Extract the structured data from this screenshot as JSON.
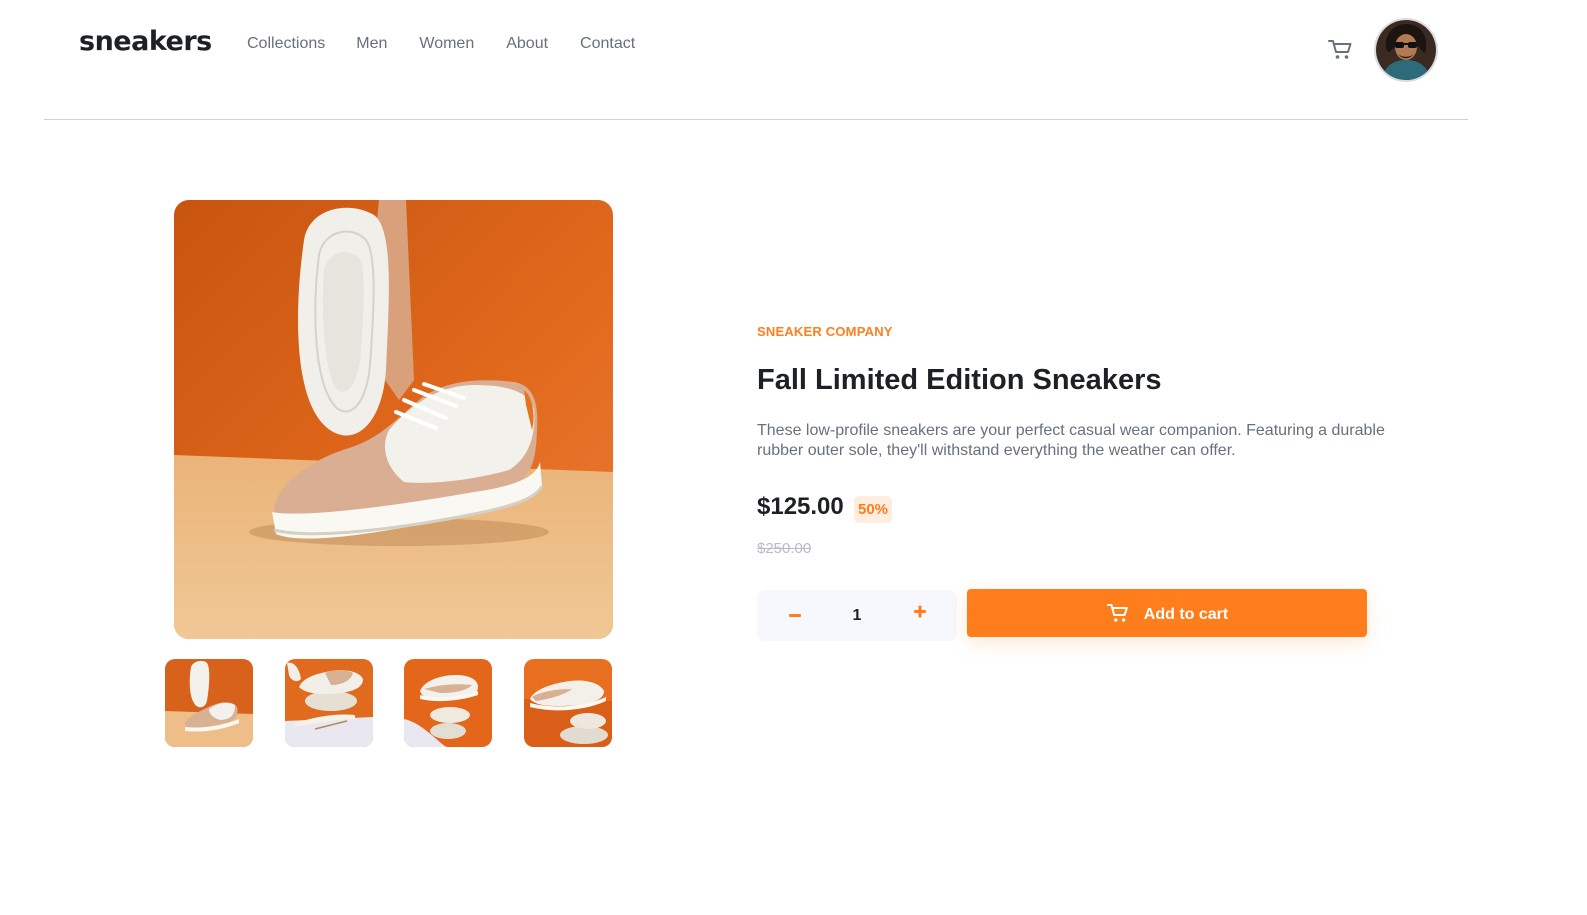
{
  "header": {
    "logo": "sneakers",
    "nav": [
      "Collections",
      "Men",
      "Women",
      "About",
      "Contact"
    ]
  },
  "product": {
    "company": "SNEAKER COMPANY",
    "title": "Fall Limited Edition Sneakers",
    "description": "These low-profile sneakers are your perfect casual wear companion. Featuring a durable rubber outer sole, they'll withstand everything the weather can offer.",
    "price": "$125.00",
    "discount": "50%",
    "original_price": "$250.00",
    "quantity": "1",
    "add_to_cart_label": "Add to cart"
  },
  "icons": {
    "cart": "cart-icon",
    "minus": "minus-icon",
    "plus": "plus-icon"
  },
  "colors": {
    "accent": "#ff7e1b",
    "accent_pale": "#ffede0",
    "text_dark": "#1d2025",
    "text_gray": "#69707d",
    "text_light": "#b6bcc8",
    "stepper_bg": "#f6f8fd"
  }
}
